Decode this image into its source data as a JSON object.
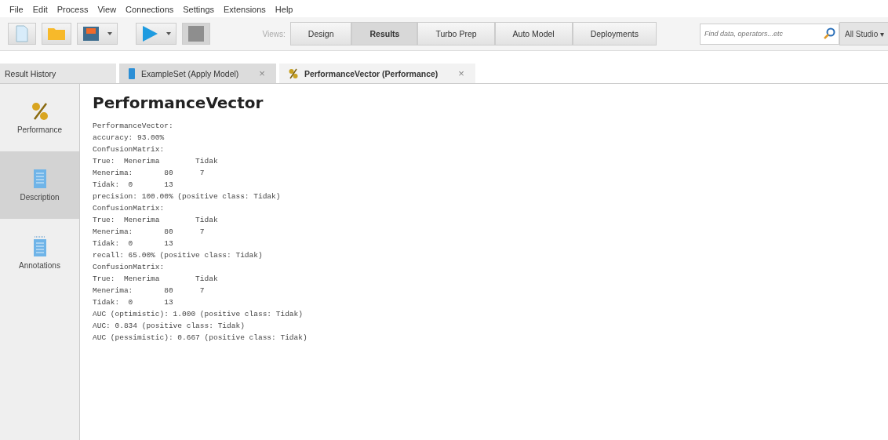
{
  "menu": [
    "File",
    "Edit",
    "Process",
    "View",
    "Connections",
    "Settings",
    "Extensions",
    "Help"
  ],
  "toolbar": {
    "views_label": "Views:",
    "views": [
      {
        "label": "Design",
        "selected": false
      },
      {
        "label": "Results",
        "selected": true
      },
      {
        "label": "Turbo Prep",
        "selected": false
      },
      {
        "label": "Auto Model",
        "selected": false
      },
      {
        "label": "Deployments",
        "selected": false
      }
    ],
    "search": {
      "placeholder": "Find data, operators...etc"
    },
    "scope": "All Studio ▾"
  },
  "tabs": [
    {
      "label": "Result History",
      "kind": "plain",
      "selected": false,
      "closable": false
    },
    {
      "label": "ExampleSet (Apply Model)",
      "kind": "data",
      "selected": false,
      "closable": true
    },
    {
      "label": "PerformanceVector (Performance)",
      "kind": "performance",
      "selected": true,
      "closable": true
    }
  ],
  "close_glyph": "×",
  "sidebar": [
    {
      "label": "Performance",
      "kind": "performance",
      "selected": false
    },
    {
      "label": "Description",
      "kind": "description",
      "selected": true
    },
    {
      "label": "Annotations",
      "kind": "annotations",
      "selected": false
    }
  ],
  "heading": "PerformanceVector",
  "lines": [
    "PerformanceVector:",
    "accuracy: 93.00%",
    "ConfusionMatrix:",
    "True:  Menerima        Tidak",
    "Menerima:       80      7",
    "Tidak:  0       13",
    "precision: 100.00% (positive class: Tidak)",
    "ConfusionMatrix:",
    "True:  Menerima        Tidak",
    "Menerima:       80      7",
    "Tidak:  0       13",
    "recall: 65.00% (positive class: Tidak)",
    "ConfusionMatrix:",
    "True:  Menerima        Tidak",
    "Menerima:       80      7",
    "Tidak:  0       13",
    "AUC (optimistic): 1.000 (positive class: Tidak)",
    "AUC: 0.834 (positive class: Tidak)",
    "AUC (pessimistic): 0.667 (positive class: Tidak)"
  ]
}
